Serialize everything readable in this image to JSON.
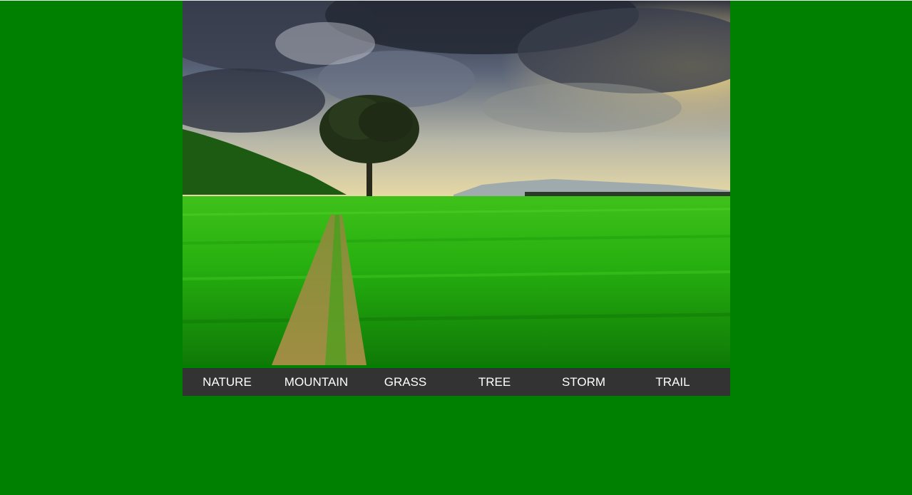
{
  "colors": {
    "page_background": "#008000",
    "nav_background": "#333333",
    "nav_text": "#ffffff"
  },
  "nav": {
    "items": [
      {
        "label": "NATURE"
      },
      {
        "label": "MOUNTAIN"
      },
      {
        "label": "GRASS"
      },
      {
        "label": "TREE"
      },
      {
        "label": "STORM"
      },
      {
        "label": "TRAIL"
      }
    ]
  }
}
